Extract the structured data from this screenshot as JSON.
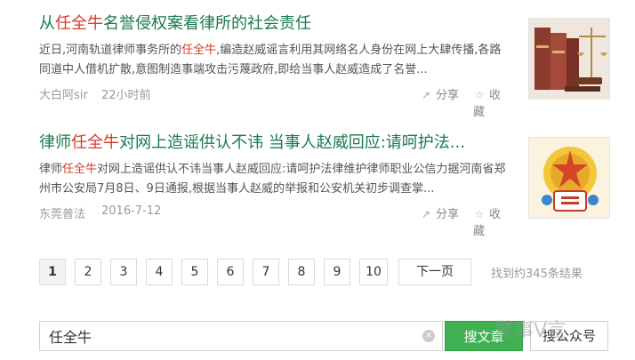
{
  "results": [
    {
      "title_hl": "任全牛",
      "title_pre": "从",
      "title_post": "名誉侵权案看律所的社会责任",
      "snippet_1a": "近日,河南轨道律师事务所的",
      "snippet_1hl": "任全牛",
      "snippet_1b": ",编造赵威谣言利用其网络名人身份在网上大肆传播,各路同道中人借机扩散,意图制造事端攻击污蔑政府,即给当事人赵威造成了名誉...",
      "source": "大白阿sir",
      "time": "22小时前",
      "share": "分享",
      "favorite": "收藏"
    },
    {
      "title_pre": "律师",
      "title_hl": "任全牛",
      "title_post": "对网上造谣供认不讳 当事人赵威回应:请呵护法...",
      "snippet_1a": "律师",
      "snippet_1hl": "任全牛",
      "snippet_1b": "对网上造谣供认不讳当事人赵威回应:请呵护法律维护律师职业公信力据河南省郑州市公安局7月8日、9日通报,根据当事人赵威的举报和公安机关初步调查掌...",
      "source": "东莞普法",
      "time": "2016-7-12",
      "share": "分享",
      "favorite": "收藏"
    }
  ],
  "pagination": {
    "pages": [
      "1",
      "2",
      "3",
      "4",
      "5",
      "6",
      "7",
      "8",
      "9",
      "10"
    ],
    "current": "1",
    "next_label": "下一页",
    "found_text": "找到约345条结果"
  },
  "search": {
    "query": "任全牛",
    "clear_symbol": "×",
    "search_articles_label": "搜文章",
    "search_accounts_label": "搜公众号"
  },
  "watermark": "警事V言",
  "icons": {
    "share": "share-icon",
    "favorite": "star-icon"
  },
  "colors": {
    "title": "#1a7a4e",
    "highlight": "#d43b2a",
    "primary_button": "#3fb153"
  }
}
